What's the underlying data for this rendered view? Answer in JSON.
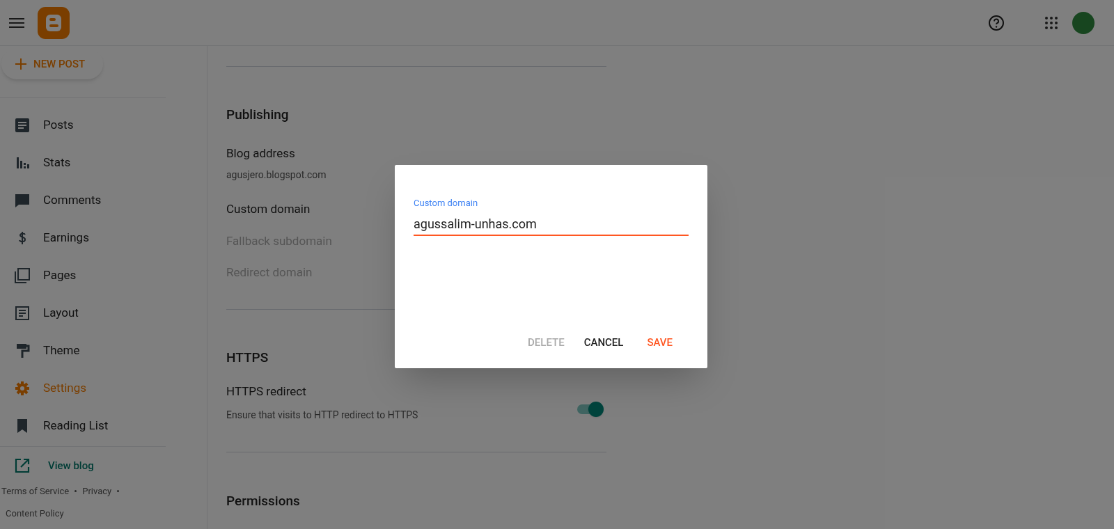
{
  "header": {
    "new_post": "NEW POST"
  },
  "sidebar": {
    "items": [
      {
        "label": "Posts",
        "selected": false
      },
      {
        "label": "Stats",
        "selected": false
      },
      {
        "label": "Comments",
        "selected": false
      },
      {
        "label": "Earnings",
        "selected": false
      },
      {
        "label": "Pages",
        "selected": false
      },
      {
        "label": "Layout",
        "selected": false
      },
      {
        "label": "Theme",
        "selected": false
      },
      {
        "label": "Settings",
        "selected": true
      },
      {
        "label": "Reading List",
        "selected": false
      }
    ],
    "view_blog": "View blog",
    "footer_links": [
      "Terms of Service",
      "Privacy",
      "Content Policy"
    ]
  },
  "publishing": {
    "title": "Publishing",
    "blog_address_label": "Blog address",
    "blog_address": "agusjero.blogspot.com",
    "rows": [
      {
        "label": "Custom domain",
        "disabled": false
      },
      {
        "label": "Fallback subdomain",
        "disabled": true
      },
      {
        "label": "Redirect domain",
        "disabled": true
      }
    ]
  },
  "https": {
    "title": "HTTPS",
    "redirect_label": "HTTPS redirect",
    "redirect_description": "Ensure that visits to HTTP redirect to HTTPS",
    "on": true
  },
  "permissions": {
    "title": "Permissions"
  },
  "dialog": {
    "field_label": "Custom domain",
    "value": "agussalim-unhas.com",
    "buttons": [
      {
        "label": "DELETE",
        "kind": "delete",
        "disabled": true
      },
      {
        "label": "CANCEL",
        "kind": "cancel",
        "disabled": false
      },
      {
        "label": "SAVE",
        "kind": "save",
        "disabled": false
      }
    ]
  }
}
